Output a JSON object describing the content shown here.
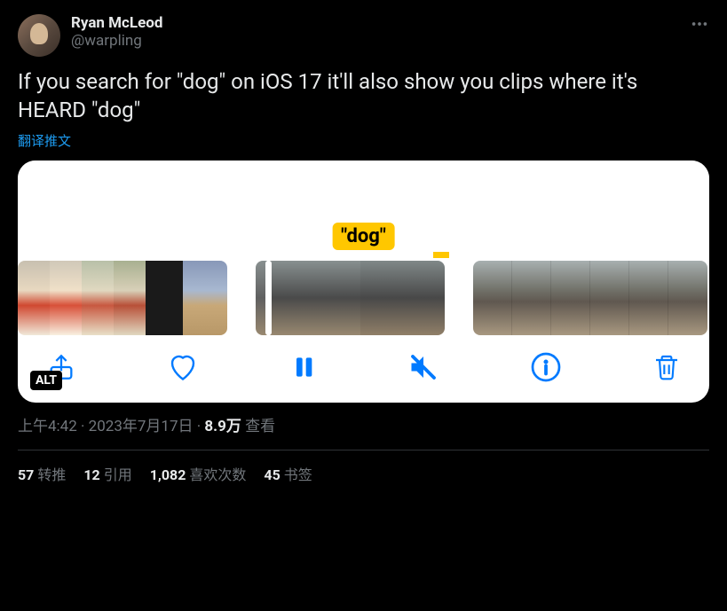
{
  "user": {
    "display_name": "Ryan McLeod",
    "handle": "@warpling"
  },
  "tweet_text": "If you search for \"dog\" on iOS 17 it'll also show you clips where it's HEARD \"dog\"",
  "translate_label": "翻译推文",
  "media": {
    "search_label": "\"dog\"",
    "alt_badge": "ALT"
  },
  "meta": {
    "time": "上午4:42",
    "date": "2023年7月17日",
    "views_count": "8.9万",
    "views_label": "查看"
  },
  "stats": {
    "retweets_count": "57",
    "retweets_label": "转推",
    "quotes_count": "12",
    "quotes_label": "引用",
    "likes_count": "1,082",
    "likes_label": "喜欢次数",
    "bookmarks_count": "45",
    "bookmarks_label": "书签"
  }
}
